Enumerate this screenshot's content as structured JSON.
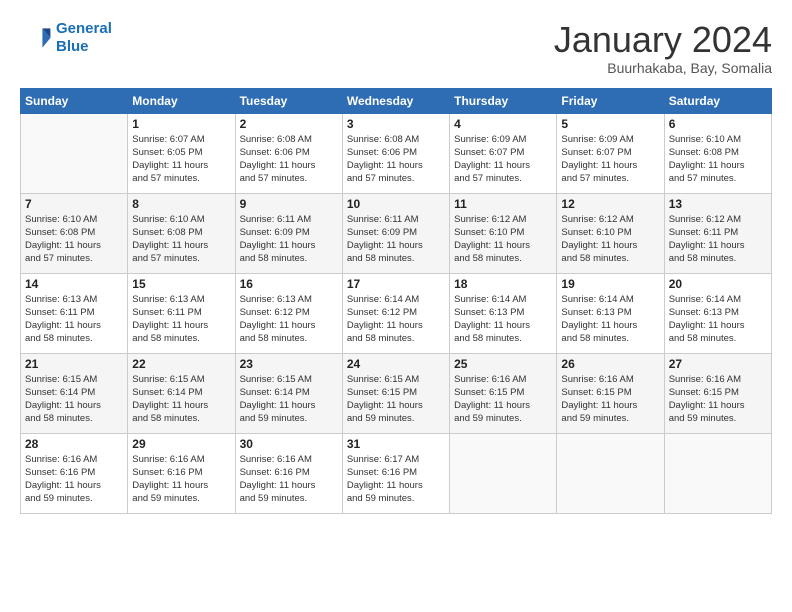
{
  "header": {
    "logo_line1": "General",
    "logo_line2": "Blue",
    "month": "January 2024",
    "location": "Buurhakaba, Bay, Somalia"
  },
  "weekdays": [
    "Sunday",
    "Monday",
    "Tuesday",
    "Wednesday",
    "Thursday",
    "Friday",
    "Saturday"
  ],
  "weeks": [
    [
      {
        "day": "",
        "info": ""
      },
      {
        "day": "1",
        "info": "Sunrise: 6:07 AM\nSunset: 6:05 PM\nDaylight: 11 hours\nand 57 minutes."
      },
      {
        "day": "2",
        "info": "Sunrise: 6:08 AM\nSunset: 6:06 PM\nDaylight: 11 hours\nand 57 minutes."
      },
      {
        "day": "3",
        "info": "Sunrise: 6:08 AM\nSunset: 6:06 PM\nDaylight: 11 hours\nand 57 minutes."
      },
      {
        "day": "4",
        "info": "Sunrise: 6:09 AM\nSunset: 6:07 PM\nDaylight: 11 hours\nand 57 minutes."
      },
      {
        "day": "5",
        "info": "Sunrise: 6:09 AM\nSunset: 6:07 PM\nDaylight: 11 hours\nand 57 minutes."
      },
      {
        "day": "6",
        "info": "Sunrise: 6:10 AM\nSunset: 6:08 PM\nDaylight: 11 hours\nand 57 minutes."
      }
    ],
    [
      {
        "day": "7",
        "info": "Sunrise: 6:10 AM\nSunset: 6:08 PM\nDaylight: 11 hours\nand 57 minutes."
      },
      {
        "day": "8",
        "info": "Sunrise: 6:10 AM\nSunset: 6:08 PM\nDaylight: 11 hours\nand 57 minutes."
      },
      {
        "day": "9",
        "info": "Sunrise: 6:11 AM\nSunset: 6:09 PM\nDaylight: 11 hours\nand 58 minutes."
      },
      {
        "day": "10",
        "info": "Sunrise: 6:11 AM\nSunset: 6:09 PM\nDaylight: 11 hours\nand 58 minutes."
      },
      {
        "day": "11",
        "info": "Sunrise: 6:12 AM\nSunset: 6:10 PM\nDaylight: 11 hours\nand 58 minutes."
      },
      {
        "day": "12",
        "info": "Sunrise: 6:12 AM\nSunset: 6:10 PM\nDaylight: 11 hours\nand 58 minutes."
      },
      {
        "day": "13",
        "info": "Sunrise: 6:12 AM\nSunset: 6:11 PM\nDaylight: 11 hours\nand 58 minutes."
      }
    ],
    [
      {
        "day": "14",
        "info": "Sunrise: 6:13 AM\nSunset: 6:11 PM\nDaylight: 11 hours\nand 58 minutes."
      },
      {
        "day": "15",
        "info": "Sunrise: 6:13 AM\nSunset: 6:11 PM\nDaylight: 11 hours\nand 58 minutes."
      },
      {
        "day": "16",
        "info": "Sunrise: 6:13 AM\nSunset: 6:12 PM\nDaylight: 11 hours\nand 58 minutes."
      },
      {
        "day": "17",
        "info": "Sunrise: 6:14 AM\nSunset: 6:12 PM\nDaylight: 11 hours\nand 58 minutes."
      },
      {
        "day": "18",
        "info": "Sunrise: 6:14 AM\nSunset: 6:13 PM\nDaylight: 11 hours\nand 58 minutes."
      },
      {
        "day": "19",
        "info": "Sunrise: 6:14 AM\nSunset: 6:13 PM\nDaylight: 11 hours\nand 58 minutes."
      },
      {
        "day": "20",
        "info": "Sunrise: 6:14 AM\nSunset: 6:13 PM\nDaylight: 11 hours\nand 58 minutes."
      }
    ],
    [
      {
        "day": "21",
        "info": "Sunrise: 6:15 AM\nSunset: 6:14 PM\nDaylight: 11 hours\nand 58 minutes."
      },
      {
        "day": "22",
        "info": "Sunrise: 6:15 AM\nSunset: 6:14 PM\nDaylight: 11 hours\nand 58 minutes."
      },
      {
        "day": "23",
        "info": "Sunrise: 6:15 AM\nSunset: 6:14 PM\nDaylight: 11 hours\nand 59 minutes."
      },
      {
        "day": "24",
        "info": "Sunrise: 6:15 AM\nSunset: 6:15 PM\nDaylight: 11 hours\nand 59 minutes."
      },
      {
        "day": "25",
        "info": "Sunrise: 6:16 AM\nSunset: 6:15 PM\nDaylight: 11 hours\nand 59 minutes."
      },
      {
        "day": "26",
        "info": "Sunrise: 6:16 AM\nSunset: 6:15 PM\nDaylight: 11 hours\nand 59 minutes."
      },
      {
        "day": "27",
        "info": "Sunrise: 6:16 AM\nSunset: 6:15 PM\nDaylight: 11 hours\nand 59 minutes."
      }
    ],
    [
      {
        "day": "28",
        "info": "Sunrise: 6:16 AM\nSunset: 6:16 PM\nDaylight: 11 hours\nand 59 minutes."
      },
      {
        "day": "29",
        "info": "Sunrise: 6:16 AM\nSunset: 6:16 PM\nDaylight: 11 hours\nand 59 minutes."
      },
      {
        "day": "30",
        "info": "Sunrise: 6:16 AM\nSunset: 6:16 PM\nDaylight: 11 hours\nand 59 minutes."
      },
      {
        "day": "31",
        "info": "Sunrise: 6:17 AM\nSunset: 6:16 PM\nDaylight: 11 hours\nand 59 minutes."
      },
      {
        "day": "",
        "info": ""
      },
      {
        "day": "",
        "info": ""
      },
      {
        "day": "",
        "info": ""
      }
    ]
  ]
}
